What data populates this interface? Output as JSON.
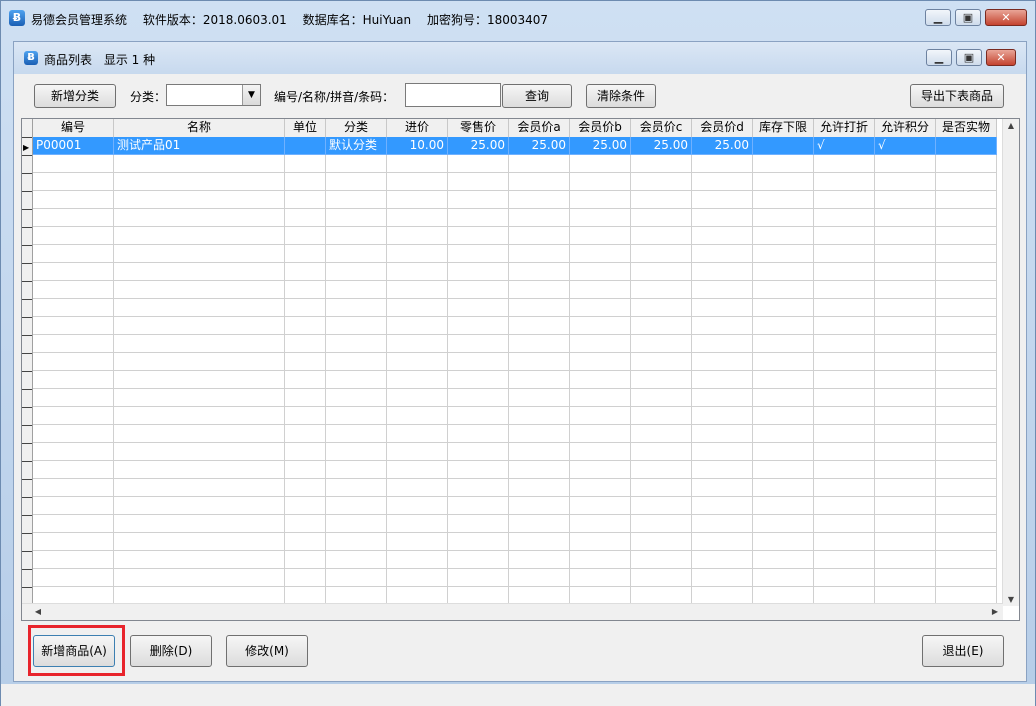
{
  "app": {
    "title_name": "易德会员管理系统",
    "version": "软件版本：2018.0603.01",
    "database": "数据库名：HuiYuan",
    "dongle": "加密狗号：18003407",
    "icon": "app-logo-icon"
  },
  "child": {
    "title": "商品列表",
    "count_text": "显示 1 种"
  },
  "toolbar": {
    "add_category": "新增分类",
    "category_label": "分类：",
    "category_value": "",
    "search_label": "编号/名称/拼音/条码：",
    "search_value": "",
    "query": "查询",
    "clear": "清除条件",
    "export": "导出下表商品"
  },
  "table": {
    "columns": [
      "编号",
      "名称",
      "单位",
      "分类",
      "进价",
      "零售价",
      "会员价a",
      "会员价b",
      "会员价c",
      "会员价d",
      "库存下限",
      "允许打折",
      "允许积分",
      "是否实物"
    ],
    "rows": [
      [
        "P00001",
        "测试产品01",
        "",
        "默认分类",
        "10.00",
        "25.00",
        "25.00",
        "25.00",
        "25.00",
        "25.00",
        "",
        "√",
        "√",
        ""
      ]
    ]
  },
  "footer": {
    "add_product": "新增商品(A)",
    "delete": "删除(D)",
    "modify": "修改(M)",
    "exit": "退出(E)"
  },
  "colors": {
    "selection": "#3399ff",
    "highlight": "#e8242c"
  }
}
